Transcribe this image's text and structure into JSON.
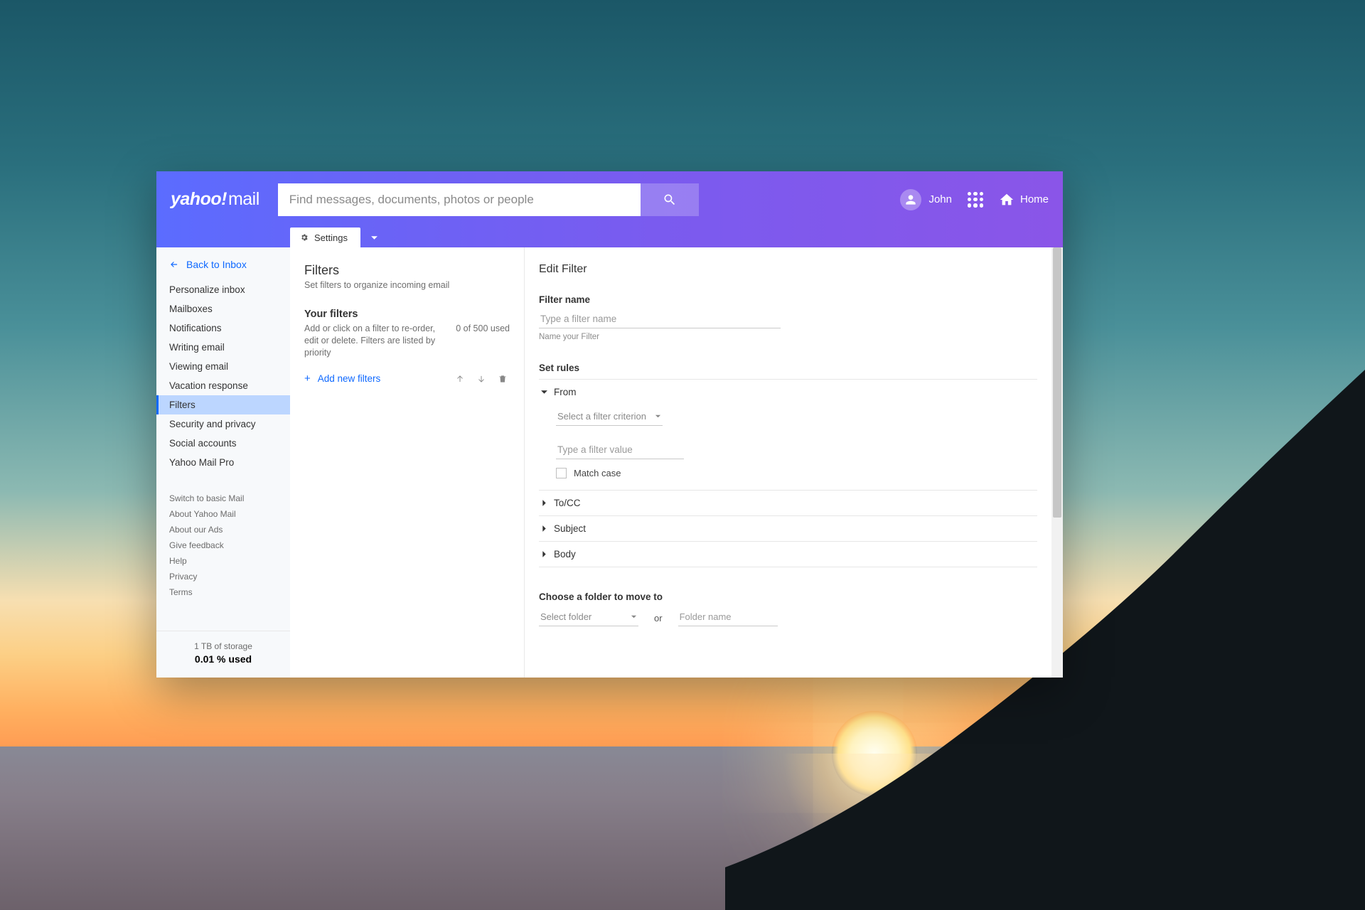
{
  "header": {
    "logo_main": "yahoo!",
    "logo_sub": "mail",
    "search_placeholder": "Find messages, documents, photos or people",
    "user_name": "John",
    "home_label": "Home"
  },
  "tabbar": {
    "settings_label": "Settings"
  },
  "sidebar": {
    "back_label": "Back to Inbox",
    "nav": [
      {
        "label": "Personalize inbox"
      },
      {
        "label": "Mailboxes"
      },
      {
        "label": "Notifications"
      },
      {
        "label": "Writing email"
      },
      {
        "label": "Viewing email"
      },
      {
        "label": "Vacation response"
      },
      {
        "label": "Filters",
        "active": true
      },
      {
        "label": "Security and privacy"
      },
      {
        "label": "Social accounts"
      },
      {
        "label": "Yahoo Mail Pro"
      }
    ],
    "mini": [
      {
        "label": "Switch to basic Mail"
      },
      {
        "label": "About Yahoo Mail"
      },
      {
        "label": "About our Ads"
      },
      {
        "label": "Give feedback"
      },
      {
        "label": "Help"
      },
      {
        "label": "Privacy"
      },
      {
        "label": "Terms"
      }
    ],
    "storage_line": "1 TB of storage",
    "storage_used": "0.01 % used"
  },
  "center": {
    "title": "Filters",
    "subtitle": "Set filters to organize incoming email",
    "yf_title": "Your filters",
    "yf_desc": "Add or click on a filter to re-order, edit or delete. Filters are listed by priority",
    "yf_count": "0 of 500 used",
    "add_label": "Add new filters"
  },
  "edit": {
    "title": "Edit Filter",
    "name_label": "Filter name",
    "name_placeholder": "Type a filter name",
    "name_hint": "Name your Filter",
    "rules_label": "Set rules",
    "rules": {
      "from": "From",
      "tocc": "To/CC",
      "subject": "Subject",
      "body": "Body"
    },
    "criterion_placeholder": "Select a filter criterion",
    "value_placeholder": "Type a filter value",
    "match_case": "Match case",
    "move_label": "Choose a folder to move to",
    "select_folder": "Select folder",
    "or": "or",
    "folder_placeholder": "Folder name"
  }
}
